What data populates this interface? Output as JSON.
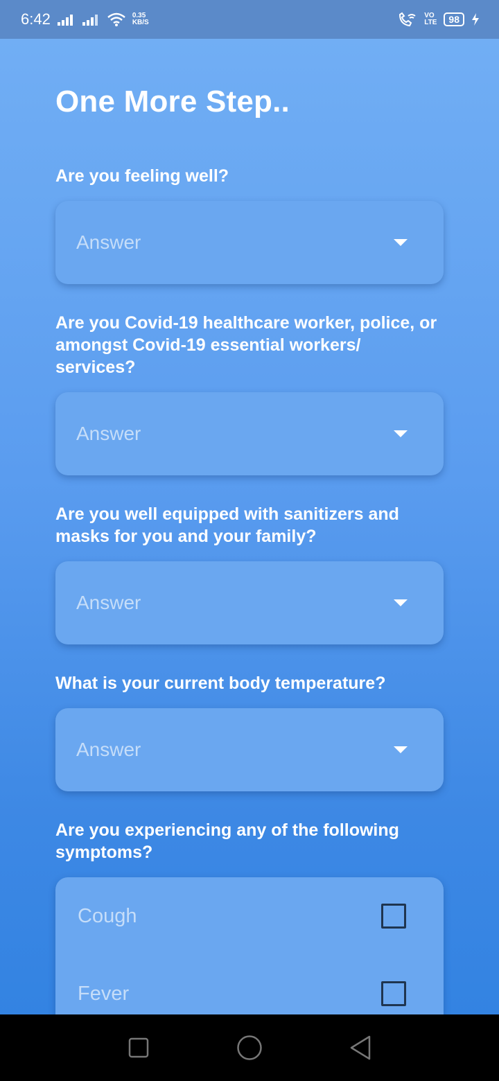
{
  "status_bar": {
    "time": "6:42",
    "net_speed_value": "0.35",
    "net_speed_unit": "KB/S",
    "volte_top": "VO",
    "volte_bottom": "LTE",
    "battery": "98"
  },
  "title": "One More Step..",
  "questions": [
    {
      "label": "Are you feeling well?",
      "placeholder": "Answer"
    },
    {
      "label": "Are you Covid-19 healthcare worker, police, or amongst Covid-19 essential workers/ services?",
      "placeholder": "Answer"
    },
    {
      "label": "Are you well equipped with sanitizers and masks for you and your family?",
      "placeholder": "Answer"
    },
    {
      "label": "What is your current body temperature?",
      "placeholder": "Answer"
    },
    {
      "label": "Are you experiencing any of the following symptoms?"
    }
  ],
  "symptoms": [
    {
      "label": "Cough",
      "checked": false
    },
    {
      "label": "Fever",
      "checked": false
    }
  ],
  "colors": {
    "gradient_top": "#71aef4",
    "gradient_bottom": "#3383e2",
    "field_bg": "#6aa7f0",
    "placeholder": "#c5ddf9"
  }
}
